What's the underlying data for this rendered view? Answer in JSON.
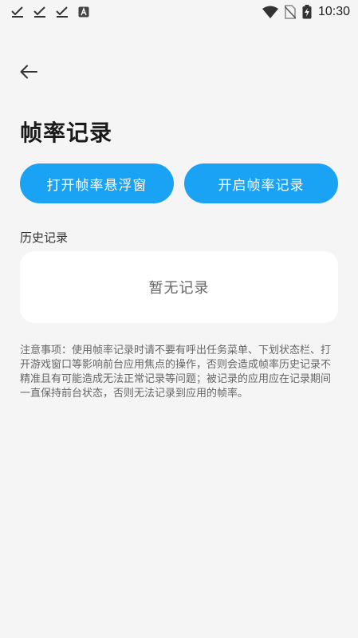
{
  "status_bar": {
    "time": "10:30",
    "left_icons": [
      "check-icon",
      "check-icon",
      "check-icon",
      "app-icon"
    ],
    "right_icons": [
      "wifi-icon",
      "no-sim-icon",
      "battery-charging-icon"
    ]
  },
  "header": {
    "back_icon": "arrow-left-icon",
    "title": "帧率记录"
  },
  "actions": {
    "float_window_label": "打开帧率悬浮窗",
    "start_record_label": "开启帧率记录"
  },
  "history": {
    "label": "历史记录",
    "empty_text": "暂无记录"
  },
  "notice": "注意事项：使用帧率记录时请不要有呼出任务菜单、下划状态栏、打开游戏窗口等影响前台应用焦点的操作，否则会造成帧率历史记录不精准且有可能造成无法正常记录等问题；被记录的应用应在记录期间一直保持前台状态，否则无法记录到应用的帧率。",
  "colors": {
    "accent": "#1aa3f5",
    "background": "#f5f5f5",
    "card": "#ffffff"
  }
}
